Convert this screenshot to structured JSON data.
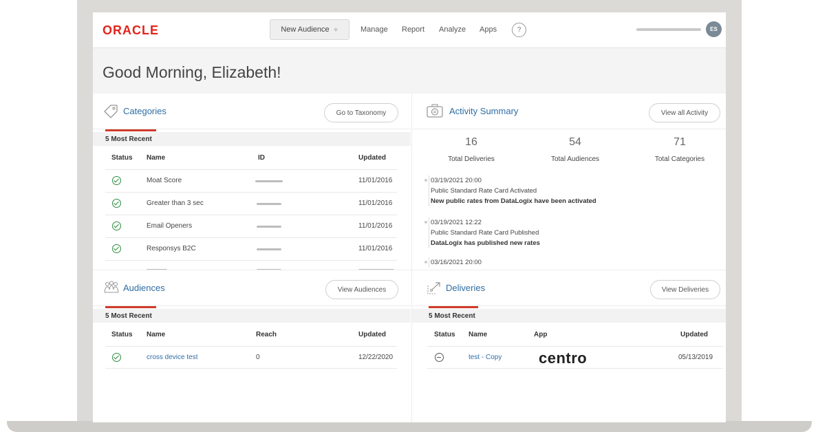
{
  "header": {
    "logo": "ORACLE",
    "new_audience": "New Audience",
    "nav": [
      "Manage",
      "Report",
      "Analyze",
      "Apps"
    ],
    "help": "?",
    "avatar_initials": "ES"
  },
  "greeting": "Good Morning, Elizabeth!",
  "categories": {
    "title": "Categories",
    "button": "Go to Taxonomy",
    "recent_label": "5 Most Recent",
    "columns": [
      "Status",
      "Name",
      "ID",
      "Updated"
    ],
    "rows": [
      {
        "name": "Moat Score",
        "updated": "11/01/2016"
      },
      {
        "name": "Greater than 3 sec",
        "updated": "11/01/2016"
      },
      {
        "name": "Email Openers",
        "updated": "11/01/2016"
      },
      {
        "name": "Responsys B2C",
        "updated": "11/01/2016"
      }
    ]
  },
  "activity": {
    "title": "Activity Summary",
    "button": "View all Activity",
    "stats": [
      {
        "value": "16",
        "label": "Total Deliveries"
      },
      {
        "value": "54",
        "label": "Total Audiences"
      },
      {
        "value": "71",
        "label": "Total Categories"
      }
    ],
    "events": [
      {
        "time": "03/19/2021 20:00",
        "line1": "Public Standard Rate Card Activated",
        "line2": "New public rates from DataLogix have been activated"
      },
      {
        "time": "03/19/2021 12:22",
        "line1": "Public Standard Rate Card Published",
        "line2": "DataLogix has published new rates"
      },
      {
        "time": "03/16/2021 20:00",
        "line1": "",
        "line2": ""
      }
    ]
  },
  "audiences": {
    "title": "Audiences",
    "button": "View Audiences",
    "recent_label": "5 Most Recent",
    "columns": [
      "Status",
      "Name",
      "Reach",
      "Updated"
    ],
    "rows": [
      {
        "name": "cross device test",
        "reach": "0",
        "updated": "12/22/2020"
      }
    ]
  },
  "deliveries": {
    "title": "Deliveries",
    "button": "View Deliveries",
    "recent_label": "5 Most Recent",
    "columns": [
      "Status",
      "Name",
      "App",
      "Updated"
    ],
    "rows": [
      {
        "name": "test - Copy",
        "app": "centro",
        "updated": "05/13/2019"
      }
    ]
  },
  "colors": {
    "accent": "#d13a2a",
    "link": "#2e6da4",
    "ok": "#2e8b3e",
    "oracle_red": "#e2231a"
  }
}
